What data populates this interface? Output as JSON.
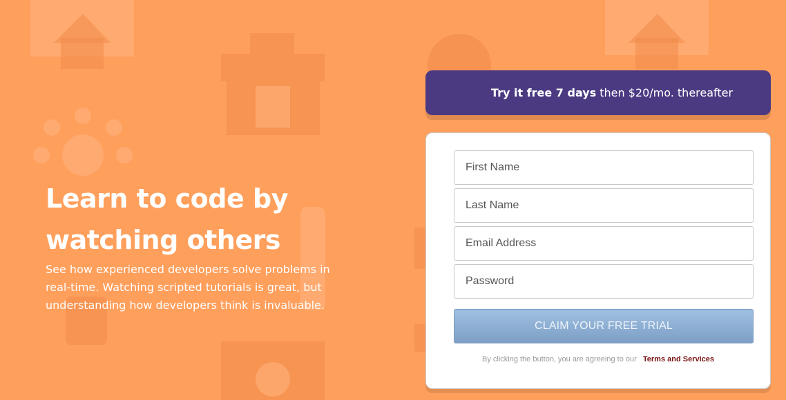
{
  "hero": {
    "title": "Learn to code by watching others",
    "description": "See how experienced developers solve problems in real-time. Watching scripted tutorials is great, but understanding how developers think is invaluable."
  },
  "promo": {
    "highlight": "Try it free 7 days",
    "rest": "then $20/mo. thereafter"
  },
  "form": {
    "first_name_placeholder": "First Name",
    "last_name_placeholder": "Last Name",
    "email_placeholder": "Email Address",
    "password_placeholder": "Password",
    "submit_label": "CLAIM YOUR FREE TRIAL",
    "terms_text": "By clicking the button, you are agreeing to our",
    "terms_link": "Terms and Services"
  },
  "colors": {
    "background": "#ff9f5c",
    "promo": "#4b3a82",
    "button": "#8eb0d4",
    "terms_link": "#7a1010"
  }
}
